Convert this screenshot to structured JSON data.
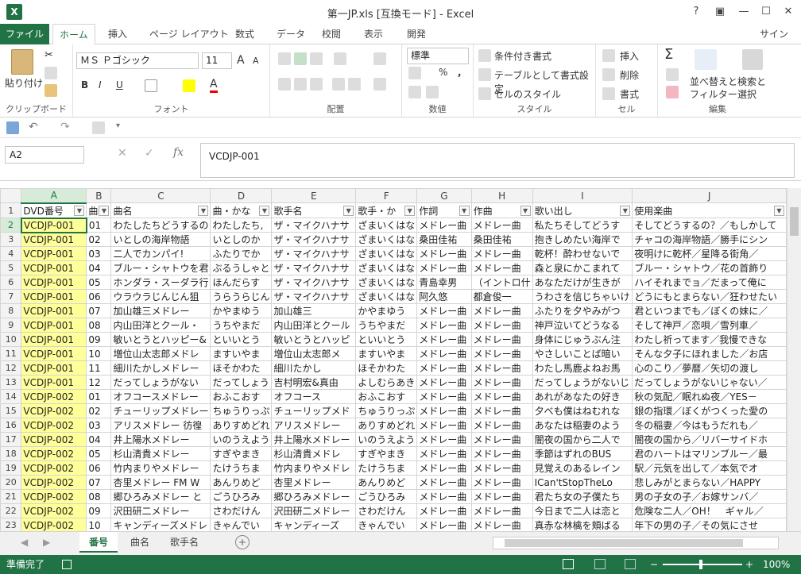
{
  "app": {
    "title": "第一JP.xls  [互換モード] - Excel",
    "logo": "X",
    "signin": "サインイン",
    "window_buttons": [
      "?",
      "▣",
      "—",
      "☐",
      "✕"
    ]
  },
  "tabs": {
    "file": "ファイル",
    "items": [
      "ホーム",
      "挿入",
      "ページ レイアウト",
      "数式",
      "データ",
      "校閲",
      "表示",
      "開発"
    ]
  },
  "ribbon": {
    "clipboard": {
      "label": "クリップボード",
      "paste": "貼り付け"
    },
    "font": {
      "label": "フォント",
      "name": "ＭＳ Ｐゴシック",
      "size": "11",
      "bold": "B",
      "italic": "I",
      "underline": "U",
      "grow": "A",
      "shrink": "A",
      "fontcolor": "A"
    },
    "align": {
      "label": "配置"
    },
    "number": {
      "label": "数値",
      "format": "標準",
      "percent": "%",
      "comma": ","
    },
    "style": {
      "label": "スタイル",
      "cond": "条件付き書式",
      "table": "テーブルとして書式設定",
      "cell": "セルのスタイル"
    },
    "cells": {
      "label": "セル",
      "insert": "挿入",
      "delete": "削除",
      "format": "書式"
    },
    "edit": {
      "label": "編集",
      "sort1": "並べ替えと",
      "sort2": "フィルター",
      "find1": "検索と",
      "find2": "選択",
      "sigma": "Σ"
    }
  },
  "formula_bar": {
    "namebox": "A2",
    "fx": "fx",
    "value": "VCDJP-001"
  },
  "grid": {
    "columns": [
      "A",
      "B",
      "C",
      "D",
      "E",
      "F",
      "G",
      "H",
      "I",
      "J"
    ],
    "headers": [
      "DVD番号",
      "曲",
      "曲名",
      "曲・かな",
      "歌手名",
      "歌手・か",
      "作詞",
      "作曲",
      "歌い出し",
      "使用楽曲"
    ],
    "rows": [
      [
        "2",
        "VCDJP-001",
        "01",
        "わたしたちどうするの",
        "わたしたち,",
        "ザ・マイクハナサ",
        "ざまいくはな",
        "メドレー曲",
        "メドレー曲",
        "私たちそしてどうす",
        "そしてどうするの？／もしかして"
      ],
      [
        "3",
        "VCDJP-001",
        "02",
        "いとしの海岸物語",
        "いとしのか",
        "ザ・マイクハナサ",
        "ざまいくはな",
        "桑田佳祐",
        "桑田佳祐",
        "抱きしめたい海岸で",
        "チャコの海岸物語／勝手にシン"
      ],
      [
        "4",
        "VCDJP-001",
        "03",
        "二人でカンパイ!",
        "ふたりでか",
        "ザ・マイクハナサ",
        "ざまいくはな",
        "メドレー曲",
        "メドレー曲",
        "乾杯！酔わせないで",
        "夜明けに乾杯／星降る街角／"
      ],
      [
        "5",
        "VCDJP-001",
        "04",
        "ブルー・シャトウを君",
        "ぶるうしゃと",
        "ザ・マイクハナサ",
        "ざまいくはな",
        "メドレー曲",
        "メドレー曲",
        "森と泉にかこまれて",
        "ブルー・シャトウ／花の首飾り"
      ],
      [
        "6",
        "VCDJP-001",
        "05",
        "ホンダラ・スーダラ行",
        "ほんだらす",
        "ザ・マイクハナサ",
        "ざまいくはな",
        "青島幸男",
        "（イントロ什",
        "あなただけが生きが",
        "ハイそれまでョ／だまって俺に"
      ],
      [
        "7",
        "VCDJP-001",
        "06",
        "ウラウラじんじん狙",
        "うらうらじん",
        "ザ・マイクハナサ",
        "ざまいくはな",
        "阿久悠",
        "都倉俊一",
        "うわさを信じちゃいけ",
        "どうにもとまらない／狂わせたい"
      ],
      [
        "8",
        "VCDJP-001",
        "07",
        "加山雄三メドレー",
        "かやまゆう",
        "加山雄三",
        "かやまゆう",
        "メドレー曲",
        "メドレー曲",
        "ふたりを夕やみがつ",
        "君といつまでも／ぼくの妹に／"
      ],
      [
        "9",
        "VCDJP-001",
        "08",
        "内山田洋とクール・",
        "うちやまだ",
        "内山田洋とクール",
        "うちやまだ",
        "メドレー曲",
        "メドレー曲",
        "神戸泣いてどうなる",
        "そして神戸／恋唄／雪列車／"
      ],
      [
        "10",
        "VCDJP-001",
        "09",
        "敏いとうとハッピー&",
        "といいとう",
        "敏いとうとハッピ",
        "といいとう",
        "メドレー曲",
        "メドレー曲",
        "身体にじゅうぶん注",
        "わたし祈ってます／我慢できな"
      ],
      [
        "11",
        "VCDJP-001",
        "10",
        "増位山太志郎メドレ",
        "ますいやま",
        "増位山太志郎メ",
        "ますいやま",
        "メドレー曲",
        "メドレー曲",
        "やさしいことば暗い",
        "そんな夕子にほれました／お店"
      ],
      [
        "12",
        "VCDJP-001",
        "11",
        "細川たかしメドレー",
        "ほそかわた",
        "細川たかし",
        "ほそかわた",
        "メドレー曲",
        "メドレー曲",
        "わたし馬鹿よねお馬",
        "心のこり／夢暦／矢切の渡し"
      ],
      [
        "13",
        "VCDJP-001",
        "12",
        "だってしょうがない",
        "だってしょう",
        "吉村明宏&真由",
        "よしむらあき",
        "メドレー曲",
        "メドレー曲",
        "だってしょうがないじ",
        "だってしょうがないじゃない／"
      ],
      [
        "14",
        "VCDJP-002",
        "01",
        "オフコースメドレー",
        "おふこおす",
        "オフコース",
        "おふこおす",
        "メドレー曲",
        "メドレー曲",
        "あれがあなたの好き",
        "秋の気配／眠れぬ夜／YES－"
      ],
      [
        "15",
        "VCDJP-002",
        "02",
        "チューリップメドレー",
        "ちゅうりっぷ",
        "チューリップメド",
        "ちゅうりっぷ",
        "メドレー曲",
        "メドレー曲",
        "夕べも僕はねむれな",
        "銀の指環／ぼくがつくった愛の"
      ],
      [
        "16",
        "VCDJP-002",
        "03",
        "アリスメドレー 彷徨",
        "ありすめどれ",
        "アリスメドレー",
        "ありすめどれ",
        "メドレー曲",
        "メドレー曲",
        "あなたは稲妻のよう",
        "冬の稲妻／今はもうだれも／"
      ],
      [
        "17",
        "VCDJP-002",
        "04",
        "井上陽水メドレー",
        "いのうえよう",
        "井上陽水メドレー",
        "いのうえよう",
        "メドレー曲",
        "メドレー曲",
        "闇夜の国から二人で",
        "闇夜の国から／リバーサイドホ"
      ],
      [
        "18",
        "VCDJP-002",
        "05",
        "杉山清貴メドレー",
        "すぎやまき",
        "杉山清貴メドレ",
        "すぎやまき",
        "メドレー曲",
        "メドレー曲",
        "季節はずれのBUS",
        "君のハートはマリンブルー／最"
      ],
      [
        "19",
        "VCDJP-002",
        "06",
        "竹内まりやメドレー",
        "たけうちま",
        "竹内まりやメドレ",
        "たけうちま",
        "メドレー曲",
        "メドレー曲",
        "見覚えのあるレイン",
        "駅／元気を出して／本気でオ"
      ],
      [
        "20",
        "VCDJP-002",
        "07",
        "杏里メドレー FM W",
        "あんりめど",
        "杏里メドレー",
        "あんりめど",
        "メドレー曲",
        "メドレー曲",
        "ICan'tStopTheLo",
        "悲しみがとまらない／HAPPY"
      ],
      [
        "21",
        "VCDJP-002",
        "08",
        "郷ひろみメドレー と",
        "ごうひろみ",
        "郷ひろみメドレー",
        "ごうひろみ",
        "メドレー曲",
        "メドレー曲",
        "君たち女の子僕たち",
        "男の子女の子／お嫁サンバ／"
      ],
      [
        "22",
        "VCDJP-002",
        "09",
        "沢田研二メドレー",
        "さわだけん",
        "沢田研二メドレー",
        "さわだけん",
        "メドレー曲",
        "メドレー曲",
        "今日まで二人は恋と",
        "危険な二人／OH！　ギャル／"
      ],
      [
        "23",
        "VCDJP-002",
        "10",
        "キャンディーズメドレ",
        "きゃんでい",
        "キャンディーズ",
        "きゃんでい",
        "メドレー曲",
        "メドレー曲",
        "真赤な林檎を頬ばる",
        "年下の男の子／その気にさせ"
      ]
    ]
  },
  "sheets": [
    "番号",
    "曲名",
    "歌手名"
  ],
  "status": {
    "ready": "準備完了",
    "zoom": "100%"
  }
}
